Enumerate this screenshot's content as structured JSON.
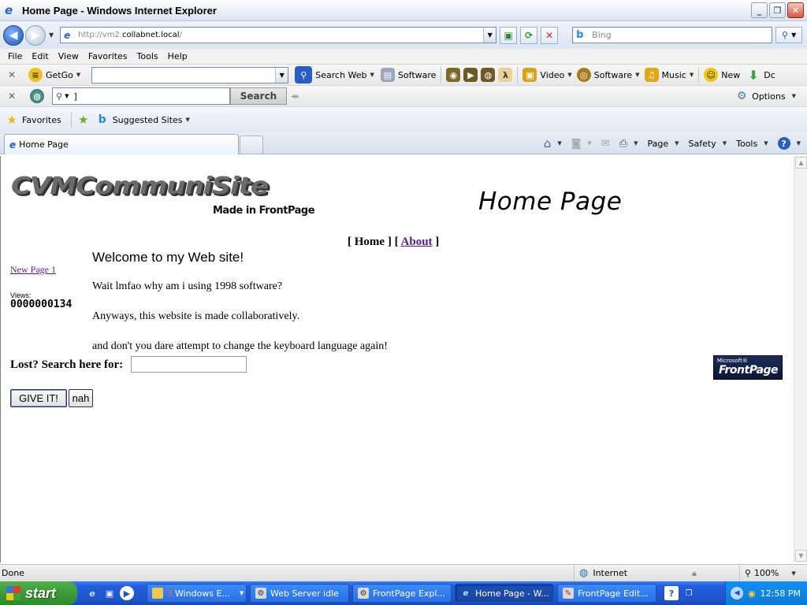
{
  "window": {
    "title": "Home Page - Windows Internet Explorer"
  },
  "address_bar": {
    "url_prefix": "http://vm2.",
    "url_host": "collabnet.local",
    "url_suffix": "/",
    "search_placeholder": "Bing"
  },
  "menu": [
    "File",
    "Edit",
    "View",
    "Favorites",
    "Tools",
    "Help"
  ],
  "toolbar1": {
    "getgo_label": "GetGo",
    "search_web_label": "Search Web",
    "software_label": "Software",
    "video_label": "Video",
    "software2_label": "Software",
    "music_label": "Music",
    "new_label": "New",
    "cut_label": "Dc"
  },
  "toolbar2": {
    "search_value": "]",
    "search_button": "Search",
    "options_label": "Options"
  },
  "favorites_bar": {
    "favorites_label": "Favorites",
    "suggested_label": "Suggested Sites"
  },
  "tabs": {
    "active_label": "Home Page"
  },
  "command_bar": {
    "page_label": "Page",
    "safety_label": "Safety",
    "tools_label": "Tools"
  },
  "page": {
    "logo_text": "CVMCommuniSite",
    "made_in": "Made in FrontPage",
    "banner": "Home Page",
    "nav": {
      "open1": "[",
      "home": "Home",
      "close_open": "] [",
      "about": "About",
      "close2": "]"
    },
    "welcome": "Welcome to my Web site!",
    "new_page_link": "New Page 1",
    "views_label": "Views:",
    "views_count": "0000000134",
    "paragraphs": [
      "Wait lmfao why am i using 1998 software?",
      "Anyways, this website is made collaboratively.",
      "and don't you dare attempt to change the keyboard language again!"
    ],
    "lost_label": "Lost? Search here for:",
    "give_button": "GIVE IT!",
    "nah_button": "nah",
    "badge_ms": "Microsoft®",
    "badge_fp": "FrontPage"
  },
  "status_bar": {
    "status": "Done",
    "zone": "Internet",
    "zoom": "100%"
  },
  "taskbar": {
    "start": "start",
    "tasks": [
      {
        "label": "Windows E...",
        "count": "3"
      },
      {
        "label": "Web Server idle"
      },
      {
        "label": "FrontPage Expl..."
      },
      {
        "label": "Home Page - W..."
      },
      {
        "label": "FrontPage Edit..."
      }
    ],
    "clock": "12:58 PM"
  }
}
